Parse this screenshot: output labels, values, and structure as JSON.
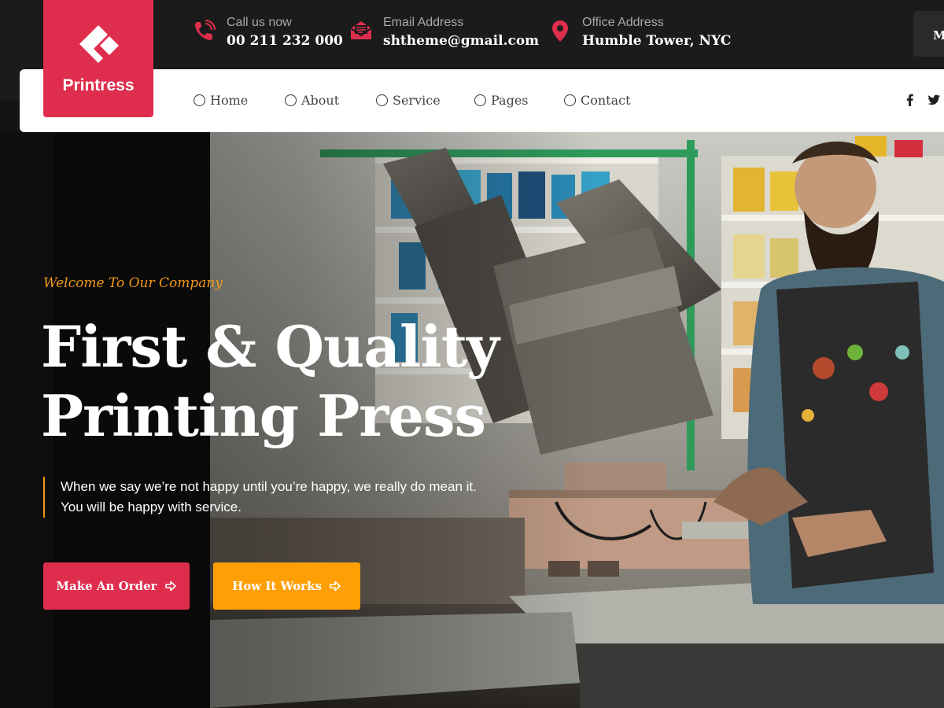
{
  "brand": {
    "name": "Printress",
    "color": "#df2e4d"
  },
  "contact": {
    "phone_label": "Call us now",
    "phone_value": "00 211 232 000",
    "email_label": "Email Address",
    "email_value": "shtheme@gmail.com",
    "office_label": "Office Address",
    "office_value": "Humble Tower, NYC"
  },
  "menu_toggle": {
    "label": "M"
  },
  "nav": {
    "items": [
      {
        "label": "Home"
      },
      {
        "label": "About"
      },
      {
        "label": "Service"
      },
      {
        "label": "Pages"
      },
      {
        "label": "Contact"
      }
    ],
    "social": [
      "facebook-icon",
      "twitter-icon"
    ]
  },
  "hero": {
    "eyebrow": "Welcome To Our Company",
    "headline_line1": "First & Quality",
    "headline_line2": "Printing Press",
    "intro_line1": "When we say we’re not happy until you’re happy, we really do mean it.",
    "intro_line2": "You will be happy with service.",
    "primary_button": "Make An Order",
    "secondary_button": "How It Works"
  },
  "colors": {
    "accent_red": "#df2e4d",
    "accent_orange": "#ff9f06",
    "eyebrow_orange": "#f39a18",
    "dark_bg": "#141414"
  }
}
